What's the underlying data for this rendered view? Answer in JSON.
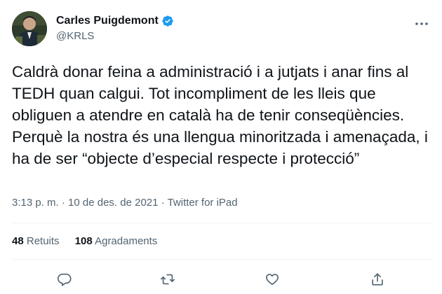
{
  "author": {
    "display_name": "Carles Puigdemont",
    "handle": "@KRLS",
    "verified": true
  },
  "tweet": {
    "text": "Caldrà donar feina a administració i a jutjats i anar fins al TEDH quan calgui. Tot incompliment de les lleis que obliguen a atendre en català ha de tenir conseqüències. Perquè la nostra és una llengua minoritzada i amenaçada, i ha de ser “objecte d’especial respecte i protecció”",
    "time": "3:13 p. m.",
    "separator": "·",
    "date": "10 de des. de 2021",
    "source": "Twitter for iPad"
  },
  "stats": {
    "retweets_count": "48",
    "retweets_label": "Retuits",
    "likes_count": "108",
    "likes_label": "Agradaments"
  },
  "icons": {
    "more": "more-horizontal-icon",
    "reply": "reply-icon",
    "retweet": "retweet-icon",
    "like": "heart-icon",
    "share": "share-icon",
    "verified": "verified-badge-icon"
  },
  "colors": {
    "text": "#0f1419",
    "secondary": "#536471",
    "verified": "#1d9bf0",
    "divider": "#eff3f4"
  }
}
